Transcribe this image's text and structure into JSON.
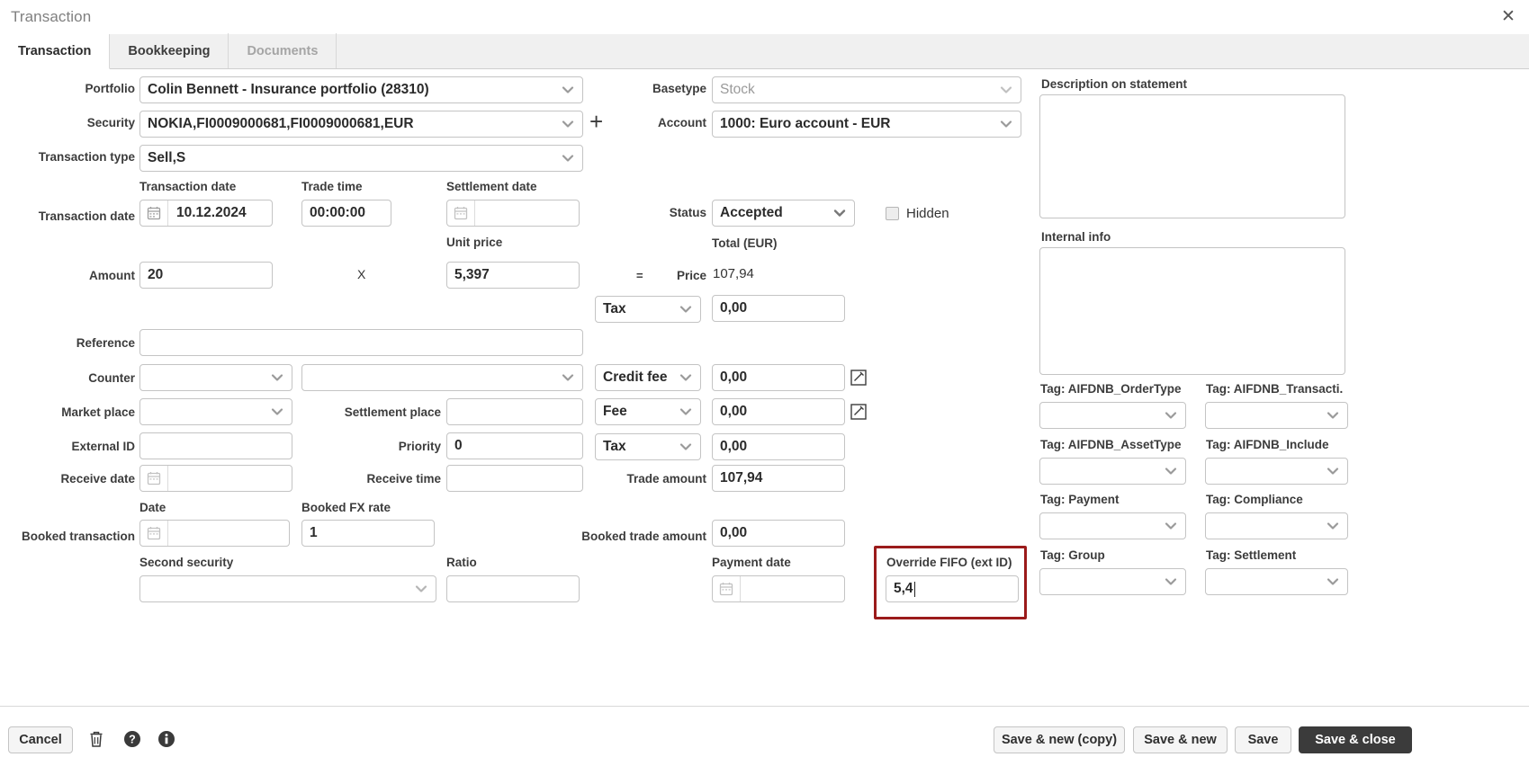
{
  "window": {
    "title": "Transaction",
    "close_icon": "close-icon"
  },
  "tabs": [
    {
      "label": "Transaction",
      "state": "active"
    },
    {
      "label": "Bookkeeping",
      "state": "normal"
    },
    {
      "label": "Documents",
      "state": "disabled"
    }
  ],
  "left": {
    "portfolio_label": "Portfolio",
    "portfolio_value": "Colin Bennett - Insurance portfolio (28310)",
    "security_label": "Security",
    "security_value": "NOKIA,FI0009000681,FI0009000681,EUR",
    "add_security_icon": "plus-icon",
    "transaction_type_label": "Transaction type",
    "transaction_type_value": "Sell,S",
    "transaction_date_label": "Transaction date",
    "transaction_date_caption": "Transaction date",
    "transaction_date_value": "10.12.2024",
    "trade_time_caption": "Trade time",
    "trade_time_value": "00:00:00",
    "settlement_date_caption": "Settlement date",
    "settlement_date_value": "",
    "amount_label": "Amount",
    "amount_value": "20",
    "times_symbol": "X",
    "unit_price_caption": "Unit price",
    "unit_price_value": "5,397",
    "equals_symbol": "=",
    "reference_label": "Reference",
    "reference_value": "",
    "counter_label": "Counter",
    "counter_value": "",
    "counter_text_value": "",
    "market_place_label": "Market place",
    "market_place_value": "",
    "settlement_place_label": "Settlement place",
    "settlement_place_value": "",
    "external_id_label": "External ID",
    "external_id_value": "",
    "priority_label": "Priority",
    "priority_value": "0",
    "receive_date_label": "Receive date",
    "receive_date_value": "",
    "receive_time_label": "Receive time",
    "receive_time_value": "",
    "booked_transaction_label": "Booked transaction",
    "booked_date_caption": "Date",
    "booked_date_value": "",
    "booked_fx_caption": "Booked FX rate",
    "booked_fx_value": "1",
    "second_security_caption": "Second security",
    "second_security_value": "",
    "ratio_caption": "Ratio",
    "ratio_value": ""
  },
  "middle": {
    "basetype_label": "Basetype",
    "basetype_value": "Stock",
    "account_label": "Account",
    "account_value": "1000: Euro account - EUR",
    "status_label": "Status",
    "status_value": "Accepted",
    "hidden_label": "Hidden",
    "hidden_checked": false,
    "total_caption": "Total (EUR)",
    "price_label": "Price",
    "price_value": "107,94",
    "tax1_select": "Tax",
    "tax1_value": "0,00",
    "credit_fee_select": "Credit fee",
    "credit_fee_value": "0,00",
    "credit_fee_edit_icon": "edit-icon",
    "fee_select": "Fee",
    "fee_value": "0,00",
    "fee_edit_icon": "edit-icon",
    "tax2_select": "Tax",
    "tax2_value": "0,00",
    "trade_amount_label": "Trade amount",
    "trade_amount_value": "107,94",
    "booked_trade_amount_label": "Booked trade amount",
    "booked_trade_amount_value": "0,00",
    "payment_date_caption": "Payment date",
    "payment_date_value": "",
    "override_fifo_caption": "Override FIFO (ext ID)",
    "override_fifo_value": "5,4",
    "override_highlight_color": "#9b1b1b"
  },
  "right": {
    "description_caption": "Description on statement",
    "description_value": "",
    "internal_info_caption": "Internal info",
    "internal_info_value": "",
    "tags": [
      {
        "caption": "Tag: AIFDNB_OrderType",
        "value": "",
        "type": "select"
      },
      {
        "caption": "Tag: AIFDNB_Transacti.",
        "value": "",
        "type": "select"
      },
      {
        "caption": "Tag: AIFDNB_AssetType",
        "value": "",
        "type": "select"
      },
      {
        "caption": "Tag: AIFDNB_Include",
        "value": "",
        "type": "select"
      },
      {
        "caption": "Tag: Payment",
        "value": "",
        "type": "select"
      },
      {
        "caption": "Tag: Compliance",
        "value": "",
        "type": "select"
      },
      {
        "caption": "Tag: Group",
        "value": "",
        "type": "select"
      },
      {
        "caption": "Tag: Settlement",
        "value": "",
        "type": "select"
      }
    ]
  },
  "footer": {
    "cancel_label": "Cancel",
    "delete_icon": "trash-icon",
    "help_icon": "help-icon",
    "info_icon": "info-icon",
    "save_new_copy_label": "Save & new (copy)",
    "save_new_label": "Save & new",
    "save_label": "Save",
    "save_close_label": "Save & close"
  }
}
